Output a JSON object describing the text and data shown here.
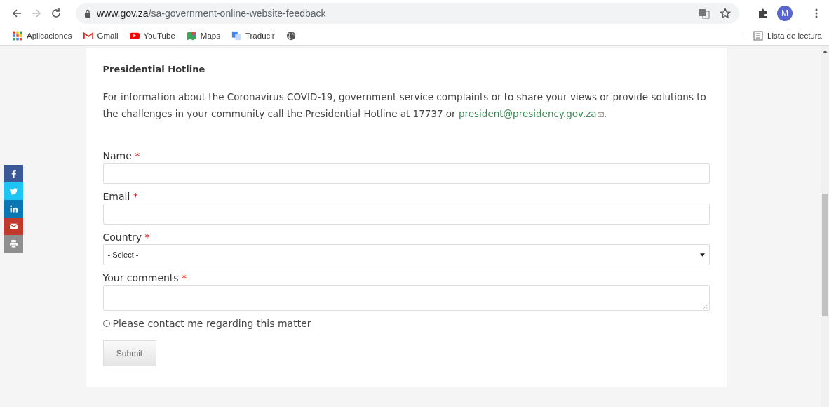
{
  "browser": {
    "url_host": "www.gov.za",
    "url_path": "/sa-government-online-website-feedback",
    "avatar": "M",
    "bookmarks": [
      {
        "kind": "apps",
        "label": "Aplicaciones"
      },
      {
        "kind": "gmail",
        "label": "Gmail"
      },
      {
        "kind": "youtube",
        "label": "YouTube"
      },
      {
        "kind": "maps",
        "label": "Maps"
      },
      {
        "kind": "translate",
        "label": "Traducir"
      },
      {
        "kind": "globe"
      }
    ],
    "reading_list": "Lista de lectura"
  },
  "share_bar": [
    {
      "kind": "facebook",
      "color": "#3b5998"
    },
    {
      "kind": "twitter",
      "color": "#1dc5f5"
    },
    {
      "kind": "linkedin",
      "color": "#0a76b4"
    },
    {
      "kind": "email",
      "color": "#c0392b"
    },
    {
      "kind": "print",
      "color": "#8f8f8f"
    }
  ],
  "heading": "Presidential Hotline",
  "intro": {
    "text": "For information about the Coronavirus COVID-19, government service complaints or to share your views or provide solutions to the challenges in your community call the Presidential Hotline at 17737 or ",
    "link": "president@presidency.gov.za",
    "after": "."
  },
  "fields": [
    {
      "kind": "text",
      "label": "Name",
      "required_mark": "*"
    },
    {
      "kind": "text",
      "label": "Email",
      "required_mark": "*"
    },
    {
      "kind": "select",
      "label": "Country",
      "required_mark": "*",
      "value": "- Select -"
    },
    {
      "kind": "textarea",
      "label": "Your comments",
      "required_mark": "*"
    }
  ],
  "contact_option": {
    "label": "Please contact me regarding this matter",
    "checked": false
  },
  "submit": "Submit"
}
